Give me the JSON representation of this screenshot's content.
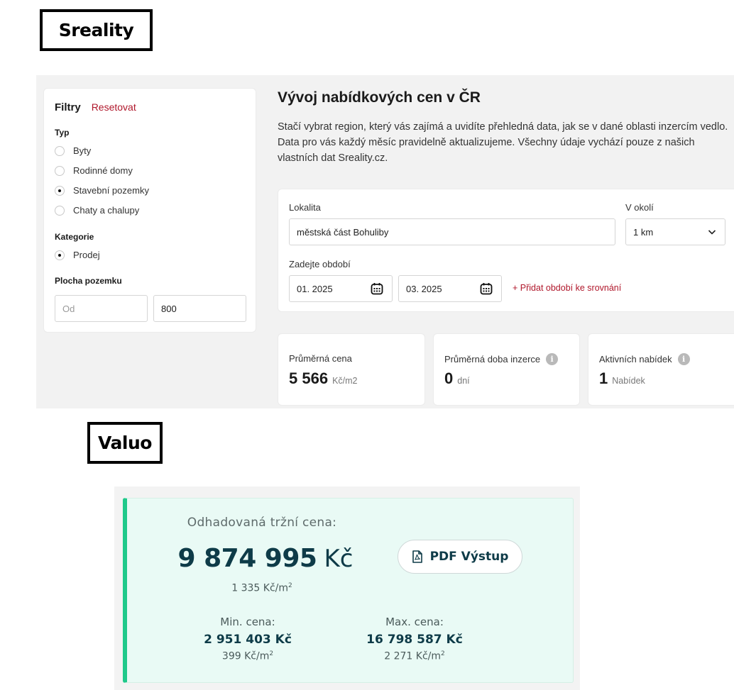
{
  "labels": {
    "sreality": "Sreality",
    "valuo": "Valuo"
  },
  "sreality": {
    "filters": {
      "title": "Filtry",
      "reset": "Resetovat",
      "type_title": "Typ",
      "type_options": [
        {
          "label": "Byty",
          "checked": false
        },
        {
          "label": "Rodinné domy",
          "checked": false
        },
        {
          "label": "Stavební pozemky",
          "checked": true
        },
        {
          "label": "Chaty a chalupy",
          "checked": false
        }
      ],
      "category_title": "Kategorie",
      "category_options": [
        {
          "label": "Prodej",
          "checked": true
        }
      ],
      "area_title": "Plocha pozemku",
      "area_from_placeholder": "Od",
      "area_to_value": "800"
    },
    "main": {
      "title": "Vývoj nabídkových cen v ČR",
      "description": "Stačí vybrat region, který vás zajímá a uvidíte přehledná data, jak se v dané oblasti inzercím vedlo. Data pro vás každý měsíc pravidelně aktualizujeme. Všechny údaje vychází pouze z našich vlastních dat Sreality.cz."
    },
    "form": {
      "location_label": "Lokalita",
      "location_value": "městská část Bohuliby",
      "radius_label": "V okolí",
      "radius_value": "1 km",
      "period_label": "Zadejte období",
      "period_from": "01. 2025",
      "period_to": "03. 2025",
      "add_period": "+ Přidat období ke srovnání"
    },
    "stats": {
      "avg_price_label": "Průměrná cena",
      "avg_price_value": "5 566",
      "avg_price_unit": "Kč/m2",
      "avg_duration_label": "Průměrná doba inzerce",
      "avg_duration_value": "0",
      "avg_duration_unit": "dní",
      "active_label": "Aktivních nabídek",
      "active_value": "1",
      "active_unit": "Nabídek"
    }
  },
  "valuo": {
    "title": "Odhadovaná tržní cena:",
    "price": "9 874 995",
    "currency": "Kč",
    "price_per_m2": "1 335 Kč/m",
    "pdf_button": "PDF Výstup",
    "min_label": "Min. cena:",
    "min_value": "2 951 403 Kč",
    "min_per_m2": "399 Kč/m",
    "max_label": "Max. cena:",
    "max_value": "16 798 587 Kč",
    "max_per_m2": "2 271 Kč/m",
    "superscript": "2"
  },
  "colors": {
    "accent_red": "#b0172b",
    "valuo_green": "#1fc98a",
    "valuo_dark": "#0e3b48",
    "valuo_bg": "#e9faf5"
  }
}
